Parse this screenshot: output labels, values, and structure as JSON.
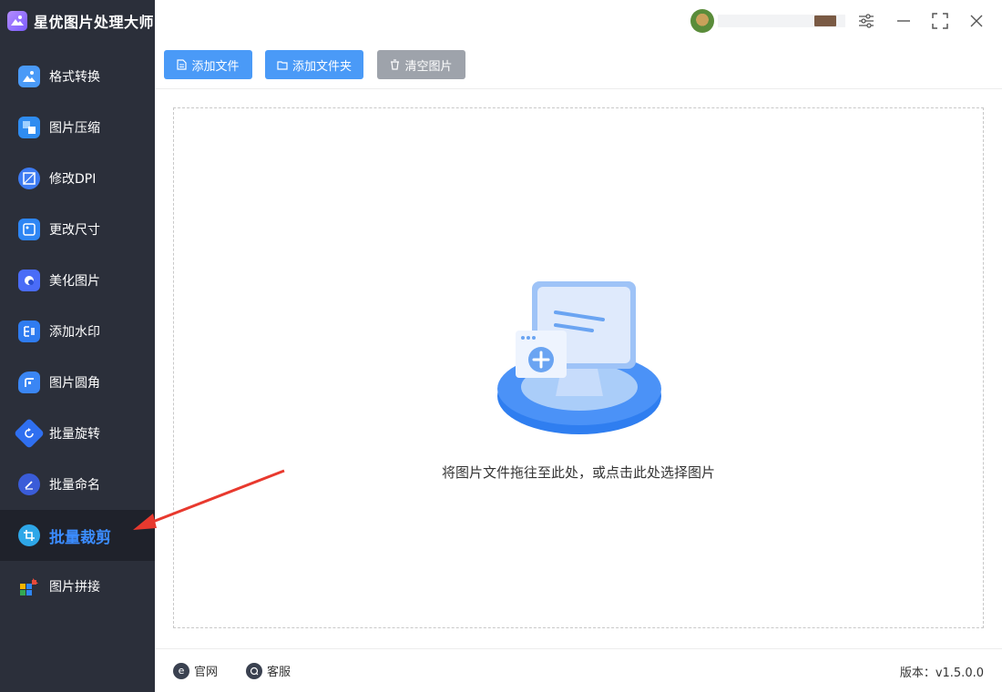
{
  "app": {
    "title": "星优图片处理大师"
  },
  "user": {
    "name_hint": ""
  },
  "sidebar": {
    "items": [
      {
        "label": "格式转换",
        "icon": "format-convert-icon",
        "color": "#4a9af7"
      },
      {
        "label": "图片压缩",
        "icon": "compress-icon",
        "color": "#2f8cf0"
      },
      {
        "label": "修改DPI",
        "icon": "dpi-icon",
        "color": "#3d7bf2"
      },
      {
        "label": "更改尺寸",
        "icon": "resize-icon",
        "color": "#2e86f4"
      },
      {
        "label": "美化图片",
        "icon": "beautify-icon",
        "color": "#4a6cf7"
      },
      {
        "label": "添加水印",
        "icon": "watermark-icon",
        "color": "#2f7cf0"
      },
      {
        "label": "图片圆角",
        "icon": "round-corner-icon",
        "color": "#3a86f4"
      },
      {
        "label": "批量旋转",
        "icon": "rotate-icon",
        "color": "#2f6ff0"
      },
      {
        "label": "批量命名",
        "icon": "rename-icon",
        "color": "#3a5cd8"
      },
      {
        "label": "批量裁剪",
        "icon": "crop-icon",
        "color": "#2ea7e8",
        "active": true
      },
      {
        "label": "图片拼接",
        "icon": "puzzle-icon",
        "color": "#e84a3a"
      }
    ]
  },
  "toolbar": {
    "add_file": "添加文件",
    "add_folder": "添加文件夹",
    "clear": "清空图片"
  },
  "dropzone": {
    "hint": "将图片文件拖往至此处，或点击此处选择图片"
  },
  "footer": {
    "website": "官网",
    "support": "客服",
    "version": "版本：v1.5.0.0"
  },
  "colors": {
    "sidebar_bg": "#2b2f3a",
    "accent": "#4a9af7",
    "active_text": "#3b8cff"
  }
}
